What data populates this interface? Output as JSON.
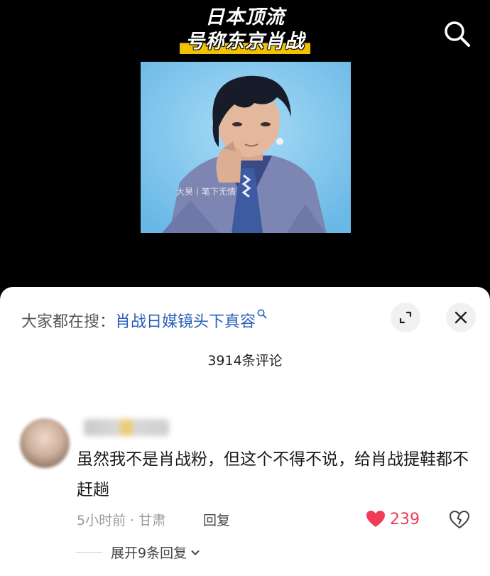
{
  "video": {
    "caption_line1": "日本顶流",
    "caption_line2": "号称东京肖战",
    "watermark": "大昊丨笔下无情"
  },
  "comments_sheet": {
    "hot_search_prefix": "大家都在搜：",
    "hot_search_query": "肖战日媒镜头下真容",
    "comment_count": "3914条评论",
    "comments": [
      {
        "text": "虽然我不是肖战粉，但这个不得不说，给肖战提鞋都不赶趟",
        "time_location": "5小时前 · 甘肃",
        "reply_label": "回复",
        "likes": "239",
        "expand_replies_label": "展开9条回复"
      }
    ]
  },
  "colors": {
    "accent_like": "#f03c56",
    "link_blue": "#2b5fb7",
    "caption_highlight": "#f2c200"
  },
  "icons": [
    "search-icon",
    "expand-icon",
    "close-icon",
    "heart-icon",
    "dislike-icon",
    "chevron-down-icon"
  ]
}
